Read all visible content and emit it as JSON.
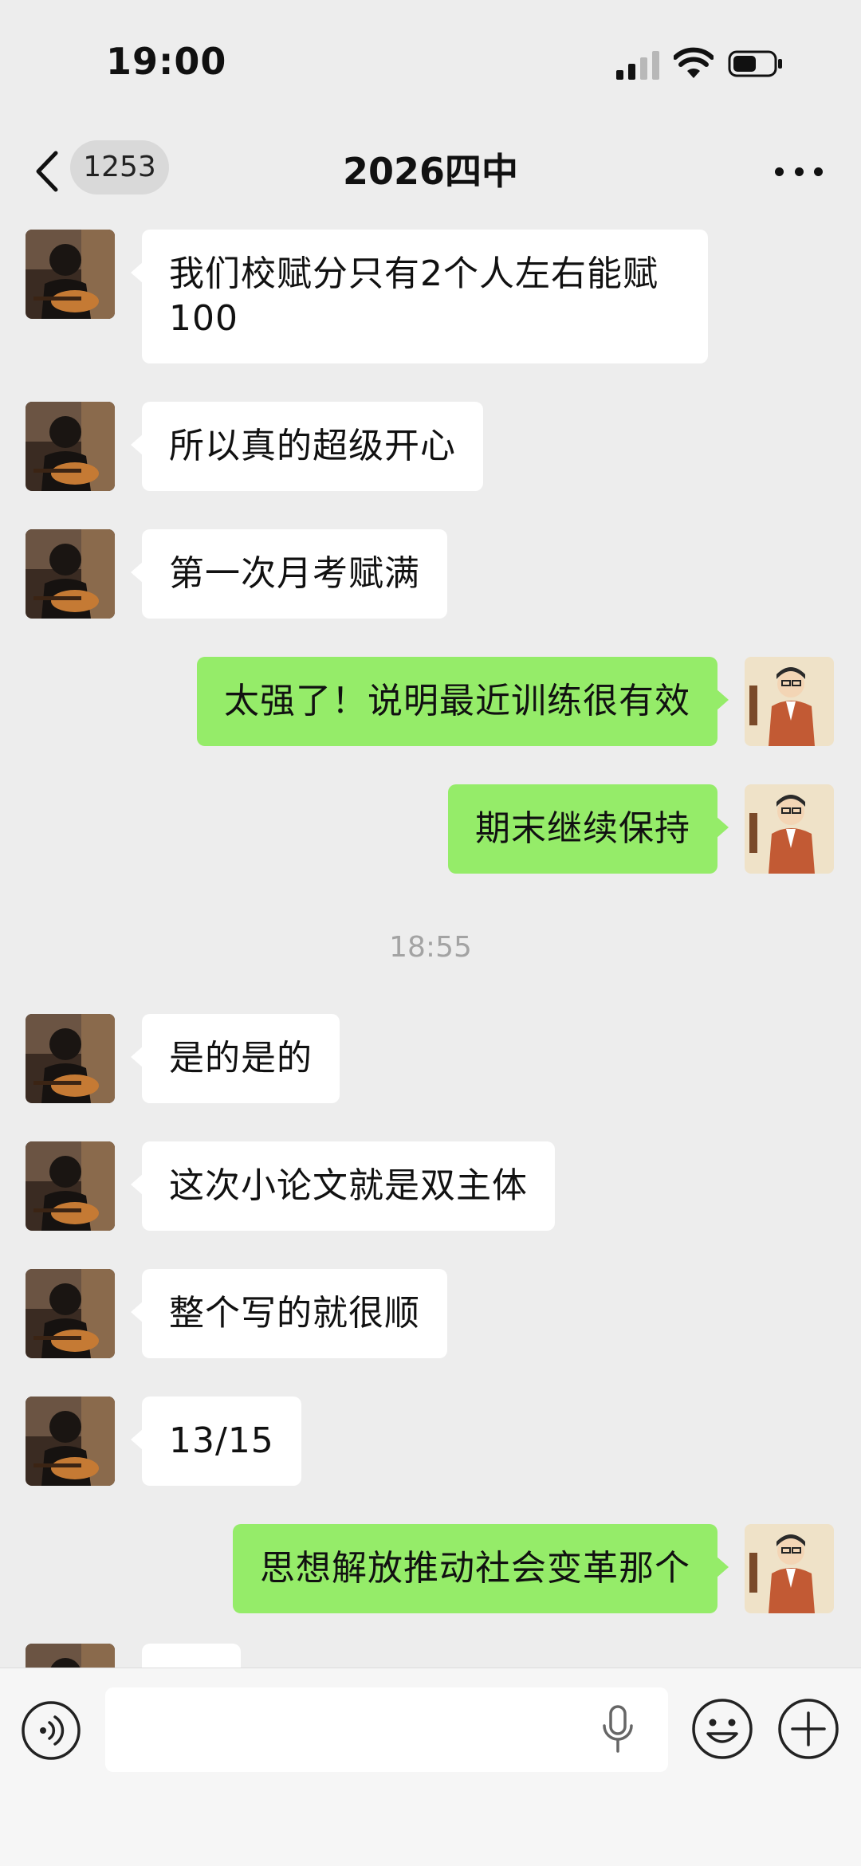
{
  "status_bar": {
    "time": "19:00"
  },
  "nav": {
    "unread_count": "1253",
    "title": "2026四中"
  },
  "messages": [
    {
      "side": "in",
      "text": "我们校赋分只有2个人左右能赋100"
    },
    {
      "side": "in",
      "text": "所以真的超级开心"
    },
    {
      "side": "in",
      "text": "第一次月考赋满"
    },
    {
      "side": "out",
      "text": "太强了！说明最近训练很有效"
    },
    {
      "side": "out",
      "text": "期末继续保持"
    },
    {
      "side": "in",
      "text": "是的是的"
    },
    {
      "side": "in",
      "text": "这次小论文就是双主体"
    },
    {
      "side": "in",
      "text": "整个写的就很顺"
    },
    {
      "side": "in",
      "text": "13/15"
    },
    {
      "side": "out",
      "text": "思想解放推动社会变革那个"
    }
  ],
  "timestamp": "18:55",
  "input": {
    "value": "",
    "placeholder": ""
  },
  "icons": {
    "back": "chevron-left-icon",
    "more": "more-dots-icon",
    "voice": "voice-mode-icon",
    "mic": "microphone-icon",
    "emoji": "emoji-icon",
    "plus": "plus-icon"
  },
  "colors": {
    "background": "#ededed",
    "outgoing_bubble": "#95ec69",
    "incoming_bubble": "#ffffff",
    "timestamp": "#a3a3a3"
  }
}
